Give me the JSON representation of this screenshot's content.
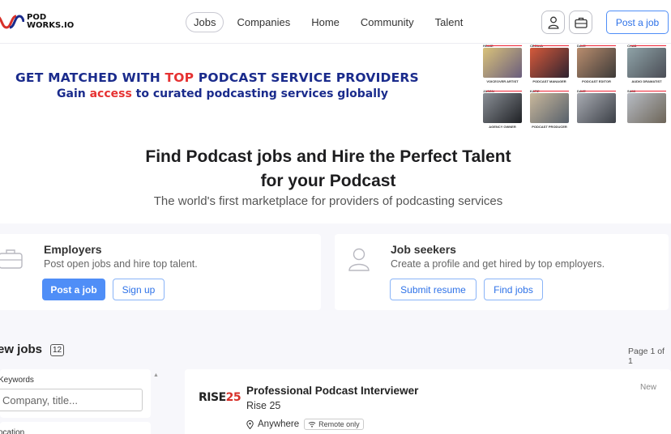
{
  "header": {
    "logo_line1": "POD",
    "logo_line2": "WORKS.IO",
    "nav": [
      "Jobs",
      "Companies",
      "Home",
      "Community",
      "Talent"
    ],
    "post_job": "Post a job",
    "icons": [
      "user-icon",
      "briefcase-icon"
    ]
  },
  "banner": {
    "headline_pre": "GET MATCHED WITH ",
    "headline_hl": "TOP",
    "headline_post": " PODCAST SERVICE PROVIDERS",
    "sub_pre": "Gain ",
    "sub_hl": "access",
    "sub_post": " to curated podcasting services globally",
    "accent_color": "#e63232",
    "brand_color": "#1a2b8c",
    "people": [
      {
        "name": "HOUIE",
        "role": "VOICEOVER ARTIST"
      },
      {
        "name": "CECILIA",
        "role": "PODCAST MANAGER"
      },
      {
        "name": "DAVE",
        "role": "PODCAST EDITOR"
      },
      {
        "name": "CHAD",
        "role": "AUDIO DRAMATIST"
      },
      {
        "name": "JASON",
        "role": "AGENCY OWNER"
      },
      {
        "name": "KATIE",
        "role": "PODCAST PRODUCER"
      },
      {
        "name": "DAVE",
        "role": ""
      },
      {
        "name": "SAMI",
        "role": ""
      }
    ]
  },
  "hero": {
    "title_line1": "Find Podcast jobs and Hire the Perfect Talent",
    "title_line2": "for your Podcast",
    "subtitle": "The world's first marketplace for providers of podcasting services"
  },
  "employers": {
    "title": "Employers",
    "text": "Post open jobs and hire top talent.",
    "primary": "Post a job",
    "secondary": "Sign up"
  },
  "seekers": {
    "title": "Job seekers",
    "text": "Create a profile and get hired by top employers.",
    "primary": "Submit resume",
    "secondary": "Find jobs"
  },
  "jobs": {
    "heading": "ew jobs",
    "count": "12",
    "page": "Page 1 of 1",
    "filters": {
      "keywords_label": "Keywords",
      "keywords_placeholder": "Company, title...",
      "location_label": "ocation"
    },
    "list": [
      {
        "logo_main": "RISE",
        "logo_num": "25",
        "title": "Professional Podcast Interviewer",
        "company": "Rise 25",
        "location": "Anywhere",
        "remote": "Remote only",
        "badge": "New"
      }
    ]
  }
}
